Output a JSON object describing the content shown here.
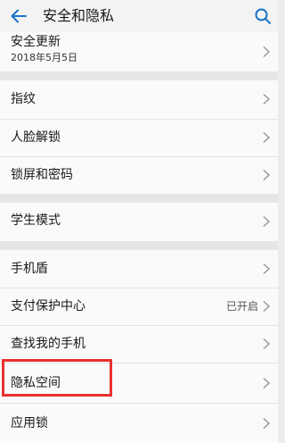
{
  "header": {
    "title": "安全和隐私",
    "back_icon": "back-arrow-icon",
    "search_icon": "search-icon"
  },
  "groups": [
    {
      "rows": [
        {
          "label": "安全更新",
          "sub": "2018年5月5日"
        }
      ]
    },
    {
      "rows": [
        {
          "label": "指纹"
        },
        {
          "label": "人脸解锁"
        },
        {
          "label": "锁屏和密码"
        }
      ]
    },
    {
      "rows": [
        {
          "label": "学生模式"
        }
      ]
    },
    {
      "rows": [
        {
          "label": "手机盾"
        },
        {
          "label": "支付保护中心",
          "value": "已开启"
        },
        {
          "label": "查找我的手机"
        },
        {
          "label": "隐私空间",
          "highlighted": true
        },
        {
          "label": "应用锁"
        }
      ]
    }
  ],
  "colors": {
    "accent": "#1a73c9",
    "highlight": "#e8322e",
    "background": "#ececec",
    "row": "#fafafa"
  }
}
